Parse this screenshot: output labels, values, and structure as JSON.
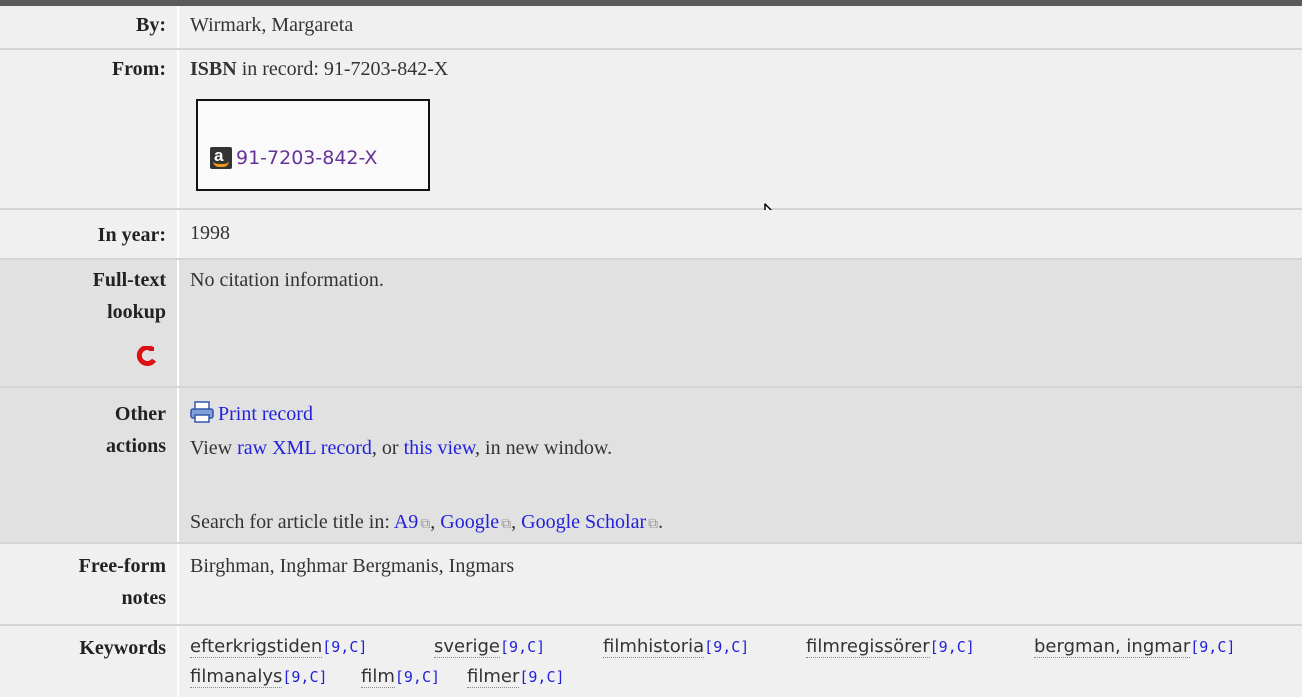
{
  "record": {
    "by": {
      "label": "By:",
      "value": "Wirmark, Margareta"
    },
    "from": {
      "label": "From:",
      "isbn_bold": "ISBN",
      "isbn_text": " in record: 91-7203-842-X",
      "amazon_link": "91-7203-842-X"
    },
    "year": {
      "label": "In year:",
      "value": "1998"
    },
    "fulltext": {
      "label_line1": "Full-text",
      "label_line2": "lookup",
      "value": "No citation information."
    },
    "actions": {
      "label_line1": "Other",
      "label_line2": "actions",
      "print": "Print record",
      "view_prefix": "View ",
      "raw_xml": "raw XML record",
      "or_text": ", or ",
      "this_view": "this view",
      "suffix": ", in new window.",
      "search_prefix": "Search for article title in: ",
      "a9": "A9",
      "google": "Google",
      "scholar": "Google Scholar",
      "comma": ", ",
      "period": "."
    },
    "notes": {
      "label_line1": "Free-form",
      "label_line2": "notes",
      "value": "Birghman, Inghmar Bergmanis, Ingmars"
    },
    "keywords": {
      "label": "Keywords",
      "items": [
        {
          "term": "efterkrigstiden",
          "meta": "[9,C]"
        },
        {
          "term": "sverige",
          "meta": "[9,C]"
        },
        {
          "term": "filmhistoria",
          "meta": "[9,C]"
        },
        {
          "term": "filmregissörer",
          "meta": "[9,C]"
        },
        {
          "term": "bergman, ingmar",
          "meta": "[9,C]"
        },
        {
          "term": "filmanalys",
          "meta": "[9,C]"
        },
        {
          "term": "film",
          "meta": "[9,C]"
        },
        {
          "term": "filmer",
          "meta": "[9,C]"
        }
      ]
    }
  },
  "icons": {
    "amazon": "amazon-icon",
    "magnet": "magnet-icon",
    "print": "printer-icon",
    "external": "external-link-icon",
    "cursor": "mouse-cursor-icon"
  },
  "colors": {
    "link": "#2222dd",
    "visited_link": "#663399",
    "row_light": "#f0f0f0",
    "row_dark": "#e1e1e1"
  }
}
